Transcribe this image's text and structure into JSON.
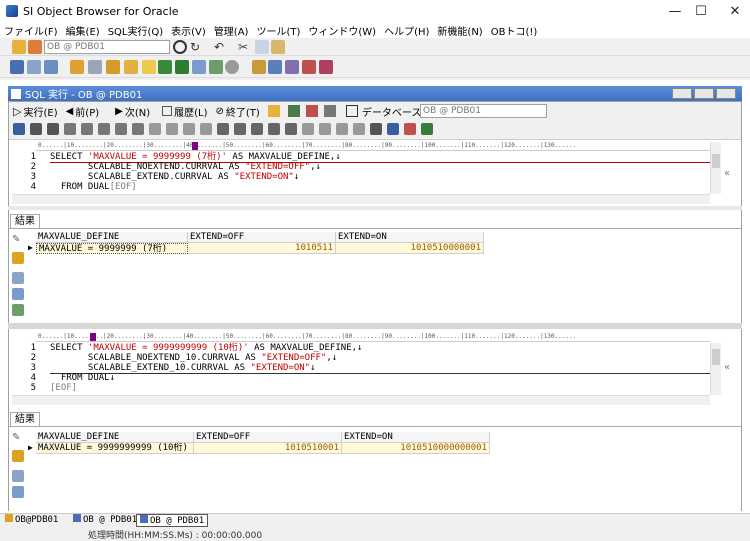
{
  "window": {
    "title": "SI Object Browser for Oracle",
    "minimize": "—",
    "maximize": "☐",
    "close": "✕"
  },
  "menu": [
    "ファイル(F)",
    "編集(E)",
    "SQL実行(Q)",
    "表示(V)",
    "管理(A)",
    "ツール(T)",
    "ウィンドウ(W)",
    "ヘルプ(H)",
    "新機能(N)",
    "OBトコ(!)"
  ],
  "toolbar": {
    "connection": "OB @ PDB01"
  },
  "child": {
    "title": "SQL 実行 - OB @ PDB01",
    "buttons": {
      "run": "実行(E)",
      "prev": "前(P)",
      "next": "次(N)",
      "history": "履歴(L)",
      "finish": "終了(T)",
      "database_label": "データベース"
    },
    "database": "OB @ PDB01"
  },
  "editor1": {
    "lines": [
      "1",
      "2",
      "3",
      "4"
    ],
    "code": [
      {
        "pre": "SELECT ",
        "str": "'MAXVALUE = 9999999 (7桁)'",
        "post": " AS MAXVALUE_DEFINE,↓"
      },
      {
        "pre": "       SCALABLE_NOEXTEND.CURRVAL AS ",
        "str": "\"EXTEND=OFF\"",
        "post": ",↓"
      },
      {
        "pre": "       SCALABLE_EXTEND.CURRVAL AS ",
        "str": "\"EXTEND=ON\"",
        "post": "↓"
      },
      {
        "pre": "  FROM DUAL",
        "str": "",
        "post": "[EOF]"
      }
    ]
  },
  "result1": {
    "tab": "結果",
    "headers": [
      "MAXVALUE_DEFINE",
      "EXTEND=OFF",
      "EXTEND=ON"
    ],
    "row": [
      "MAXVALUE = 9999999 (7桁)",
      "1010511",
      "1010510000001"
    ]
  },
  "editor2": {
    "lines": [
      "1",
      "2",
      "3",
      "4",
      "5"
    ],
    "code": [
      {
        "pre": "SELECT ",
        "str": "'MAXVALUE = 9999999999 (10桁)'",
        "post": " AS MAXVALUE_DEFINE,↓"
      },
      {
        "pre": "       SCALABLE_NOEXTEND_10.CURRVAL AS ",
        "str": "\"EXTEND=OFF\"",
        "post": ",↓"
      },
      {
        "pre": "       SCALABLE_EXTEND_10.CURRVAL AS ",
        "str": "\"EXTEND=ON\"",
        "post": "↓"
      },
      {
        "pre": "  FROM DUAL↓",
        "str": "",
        "post": ""
      },
      {
        "pre": "",
        "str": "",
        "post": "[EOF]"
      }
    ]
  },
  "result2": {
    "tab": "結果",
    "headers": [
      "MAXVALUE_DEFINE",
      "EXTEND=OFF",
      "EXTEND=ON"
    ],
    "row": [
      "MAXVALUE = 9999999999 (10桁)",
      "1010510001",
      "1010510000000001"
    ]
  },
  "tabs": [
    "OB@PDB01",
    "OB @ PDB01",
    "OB @ PDB01"
  ],
  "status": "処理時間(HH:MM:SS.Ms) : 00:00:00.000"
}
